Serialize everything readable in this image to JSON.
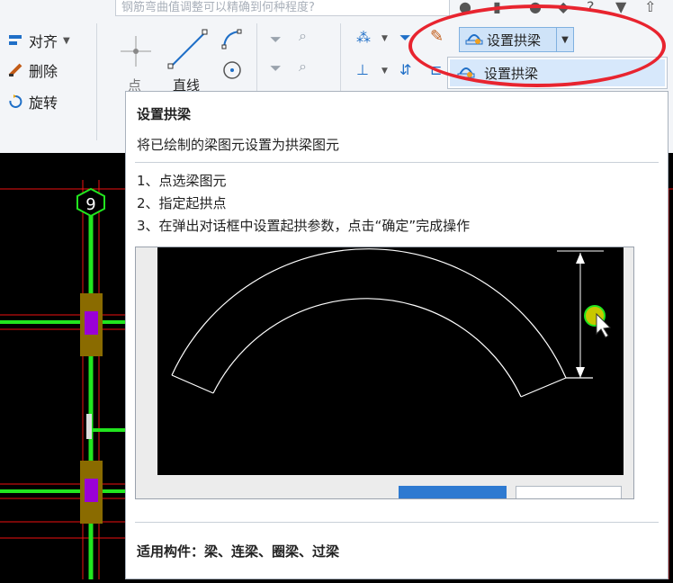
{
  "search": {
    "placeholder": "钢筋弯曲值调整可以精确到何种程度?"
  },
  "left_tools": [
    {
      "label": "对齐",
      "icon": "align-icon"
    },
    {
      "label": "删除",
      "icon": "eraser-icon"
    },
    {
      "label": "旋转",
      "icon": "rotate-icon"
    }
  ],
  "draw_tools": {
    "point_label": "点",
    "line_label": "直线"
  },
  "arch_button": {
    "label": "设置拱梁",
    "icon": "arch-beam-icon"
  },
  "arch_menu": {
    "item_label": "设置拱梁"
  },
  "tooltip": {
    "title": "设置拱梁",
    "description": "将已绘制的梁图元设置为拱梁图元",
    "steps": [
      "1、点选梁图元",
      "2、指定起拱点",
      "3、在弹出对话框中设置起拱参数，点击“确定”完成操作"
    ],
    "applies_to": "适用构件：梁、连梁、圈梁、过梁"
  },
  "cad": {
    "axis_label": "9"
  },
  "colors": {
    "accent": "#1f6fc7",
    "highlight_ring": "#e8242f",
    "beam": "#22e51f",
    "column": "#9a00d6"
  }
}
